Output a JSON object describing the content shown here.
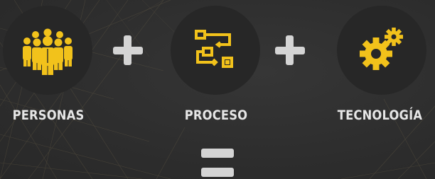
{
  "colors": {
    "background": "#2e2e2e",
    "circle": "#272727",
    "icon_accent": "#f2c21b",
    "operator": "#d4d4d4",
    "label_text": "#e6e6e6"
  },
  "items": [
    {
      "label": "PERSONAS",
      "icon": "people-group-icon"
    },
    {
      "label": "PROCESO",
      "icon": "process-flow-icon"
    },
    {
      "label": "TECNOLOGÍA",
      "icon": "gears-icon"
    }
  ],
  "operators": [
    "plus",
    "plus",
    "equals"
  ]
}
